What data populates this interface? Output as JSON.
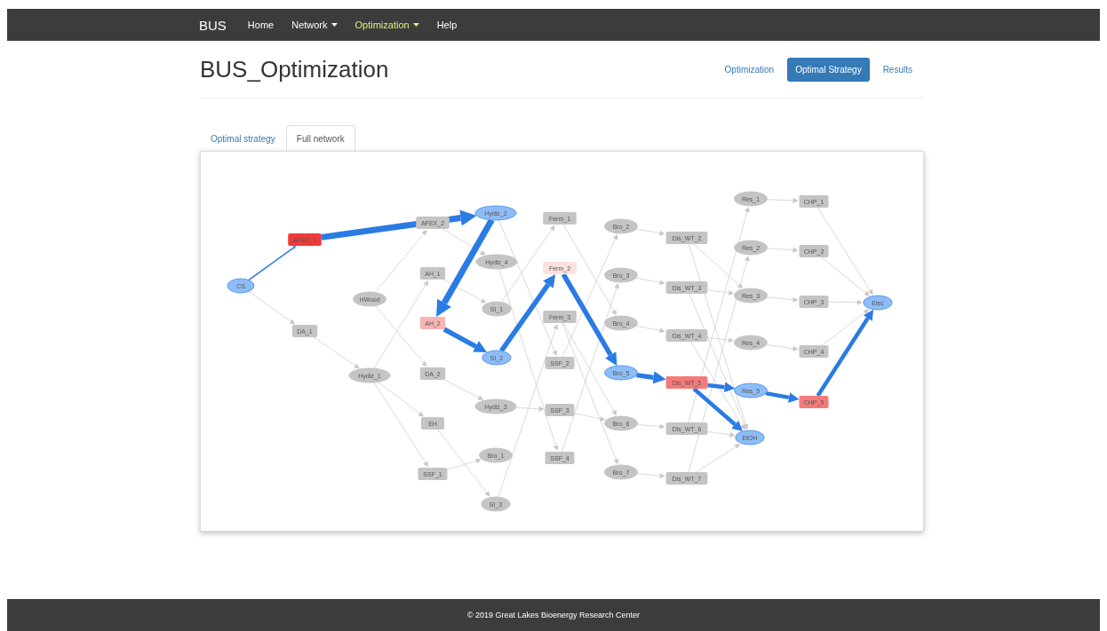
{
  "navbar": {
    "brand": "BUS",
    "items": [
      {
        "label": "Home",
        "dropdown": false,
        "selected": false
      },
      {
        "label": "Network",
        "dropdown": true,
        "selected": false
      },
      {
        "label": "Optimization",
        "dropdown": true,
        "selected": true
      },
      {
        "label": "Help",
        "dropdown": false,
        "selected": false
      }
    ]
  },
  "page_title": "BUS_Optimization",
  "pills": [
    {
      "label": "Optimization",
      "selected": false
    },
    {
      "label": "Optimal Strategy",
      "selected": true
    },
    {
      "label": "Results",
      "selected": false
    }
  ],
  "tabs": [
    {
      "label": "Optimal strategy",
      "selected": false
    },
    {
      "label": "Full network",
      "selected": true
    }
  ],
  "network": {
    "nodes": [
      {
        "label": "CS",
        "kind": "ellipse",
        "color": "#8ebcf6"
      },
      {
        "label": "AFEX_1",
        "kind": "rect",
        "color": "#f03a3a"
      },
      {
        "label": "AFEX_2",
        "kind": "rect",
        "color": "#c4c4c4"
      },
      {
        "label": "Hydlz_2",
        "kind": "ellipse",
        "color": "#8ebcf6"
      },
      {
        "label": "Hydlz_4",
        "kind": "ellipse",
        "color": "#c4c4c4"
      },
      {
        "label": "HWood",
        "kind": "ellipse",
        "color": "#c4c4c4"
      },
      {
        "label": "AH_1",
        "kind": "rect",
        "color": "#c4c4c4"
      },
      {
        "label": "AH_2",
        "kind": "rect",
        "color": "#f7b4b4"
      },
      {
        "label": "SI_1",
        "kind": "ellipse",
        "color": "#c4c4c4"
      },
      {
        "label": "SI_2",
        "kind": "ellipse",
        "color": "#8ebcf6"
      },
      {
        "label": "DA_1",
        "kind": "rect",
        "color": "#c4c4c4"
      },
      {
        "label": "Hydlz_1",
        "kind": "ellipse",
        "color": "#c4c4c4"
      },
      {
        "label": "DA_2",
        "kind": "rect",
        "color": "#c4c4c4"
      },
      {
        "label": "Hydlz_3",
        "kind": "ellipse",
        "color": "#c4c4c4"
      },
      {
        "label": "EH",
        "kind": "rect",
        "color": "#c4c4c4"
      },
      {
        "label": "SSF_1",
        "kind": "rect",
        "color": "#c4c4c4"
      },
      {
        "label": "Bro_1",
        "kind": "ellipse",
        "color": "#c4c4c4"
      },
      {
        "label": "SI_3",
        "kind": "ellipse",
        "color": "#c4c4c4"
      },
      {
        "label": "Ferm_1",
        "kind": "rect",
        "color": "#c4c4c4"
      },
      {
        "label": "Ferm_2",
        "kind": "rect",
        "color": "#fde0e0"
      },
      {
        "label": "Ferm_3",
        "kind": "rect",
        "color": "#c4c4c4"
      },
      {
        "label": "SSF_2",
        "kind": "rect",
        "color": "#c4c4c4"
      },
      {
        "label": "SSF_3",
        "kind": "rect",
        "color": "#c4c4c4"
      },
      {
        "label": "SSF_4",
        "kind": "rect",
        "color": "#c4c4c4"
      },
      {
        "label": "Bro_2",
        "kind": "ellipse",
        "color": "#c4c4c4"
      },
      {
        "label": "Bro_3",
        "kind": "ellipse",
        "color": "#c4c4c4"
      },
      {
        "label": "Bro_4",
        "kind": "ellipse",
        "color": "#c4c4c4"
      },
      {
        "label": "Bro_5",
        "kind": "ellipse",
        "color": "#8ebcf6"
      },
      {
        "label": "Bro_6",
        "kind": "ellipse",
        "color": "#c4c4c4"
      },
      {
        "label": "Bro_7",
        "kind": "ellipse",
        "color": "#c4c4c4"
      },
      {
        "label": "Dis_WT_2",
        "kind": "rect",
        "color": "#c4c4c4"
      },
      {
        "label": "Dis_WT_3",
        "kind": "rect",
        "color": "#c4c4c4"
      },
      {
        "label": "Dis_WT_4",
        "kind": "rect",
        "color": "#c4c4c4"
      },
      {
        "label": "Dis_WT_5",
        "kind": "rect",
        "color": "#f47a7a"
      },
      {
        "label": "Dis_WT_6",
        "kind": "rect",
        "color": "#c4c4c4"
      },
      {
        "label": "Dis_WT_7",
        "kind": "rect",
        "color": "#c4c4c4"
      },
      {
        "label": "Res_1",
        "kind": "ellipse",
        "color": "#c4c4c4"
      },
      {
        "label": "Res_2",
        "kind": "ellipse",
        "color": "#c4c4c4"
      },
      {
        "label": "Res_3",
        "kind": "ellipse",
        "color": "#c4c4c4"
      },
      {
        "label": "Res_4",
        "kind": "ellipse",
        "color": "#c4c4c4"
      },
      {
        "label": "Res_5",
        "kind": "ellipse",
        "color": "#8ebcf6"
      },
      {
        "label": "CHP_1",
        "kind": "rect",
        "color": "#c4c4c4"
      },
      {
        "label": "CHP_2",
        "kind": "rect",
        "color": "#c4c4c4"
      },
      {
        "label": "CHP_3",
        "kind": "rect",
        "color": "#c4c4c4"
      },
      {
        "label": "CHP_4",
        "kind": "rect",
        "color": "#c4c4c4"
      },
      {
        "label": "CHP_5",
        "kind": "rect",
        "color": "#f47a7a"
      },
      {
        "label": "EtOH",
        "kind": "ellipse",
        "color": "#8ebcf6"
      },
      {
        "label": "Elec",
        "kind": "ellipse",
        "color": "#8ebcf6"
      }
    ],
    "edges": [
      {
        "kind": "idle"
      },
      {
        "kind": "idle"
      },
      {
        "kind": "idle"
      },
      {
        "kind": "idle"
      },
      {
        "kind": "idle"
      },
      {
        "kind": "idle"
      },
      {
        "kind": "idle"
      },
      {
        "kind": "idle"
      },
      {
        "kind": "idle"
      },
      {
        "kind": "idle"
      },
      {
        "kind": "idle"
      },
      {
        "kind": "idle"
      },
      {
        "kind": "idle"
      },
      {
        "kind": "idle"
      },
      {
        "kind": "idle"
      },
      {
        "kind": "idle"
      },
      {
        "kind": "idle"
      },
      {
        "kind": "idle"
      },
      {
        "kind": "idle"
      },
      {
        "kind": "idle"
      },
      {
        "kind": "idle"
      },
      {
        "kind": "idle"
      },
      {
        "kind": "idle"
      },
      {
        "kind": "idle"
      },
      {
        "kind": "idle"
      },
      {
        "kind": "idle"
      },
      {
        "kind": "idle"
      },
      {
        "kind": "idle"
      },
      {
        "kind": "idle"
      },
      {
        "kind": "idle"
      },
      {
        "kind": "idle"
      },
      {
        "kind": "idle"
      },
      {
        "kind": "idle"
      },
      {
        "kind": "idle"
      },
      {
        "kind": "idle"
      },
      {
        "kind": "idle"
      },
      {
        "kind": "idle"
      },
      {
        "kind": "idle"
      },
      {
        "kind": "idle"
      },
      {
        "kind": "idle"
      },
      {
        "kind": "idle"
      },
      {
        "kind": "idle"
      },
      {
        "kind": "idle"
      },
      {
        "kind": "idle"
      },
      {
        "kind": "idle"
      },
      {
        "kind": "idle"
      },
      {
        "kind": "thin"
      },
      {
        "kind": "heavy"
      },
      {
        "kind": "heavy"
      },
      {
        "kind": "bold"
      },
      {
        "kind": "bold"
      },
      {
        "kind": "bold"
      },
      {
        "kind": "bold"
      },
      {
        "kind": "medium"
      },
      {
        "kind": "medium"
      },
      {
        "kind": "medium"
      },
      {
        "kind": "medium"
      }
    ]
  },
  "footer": "© 2019 Great Lakes Bioenergy Research Center"
}
